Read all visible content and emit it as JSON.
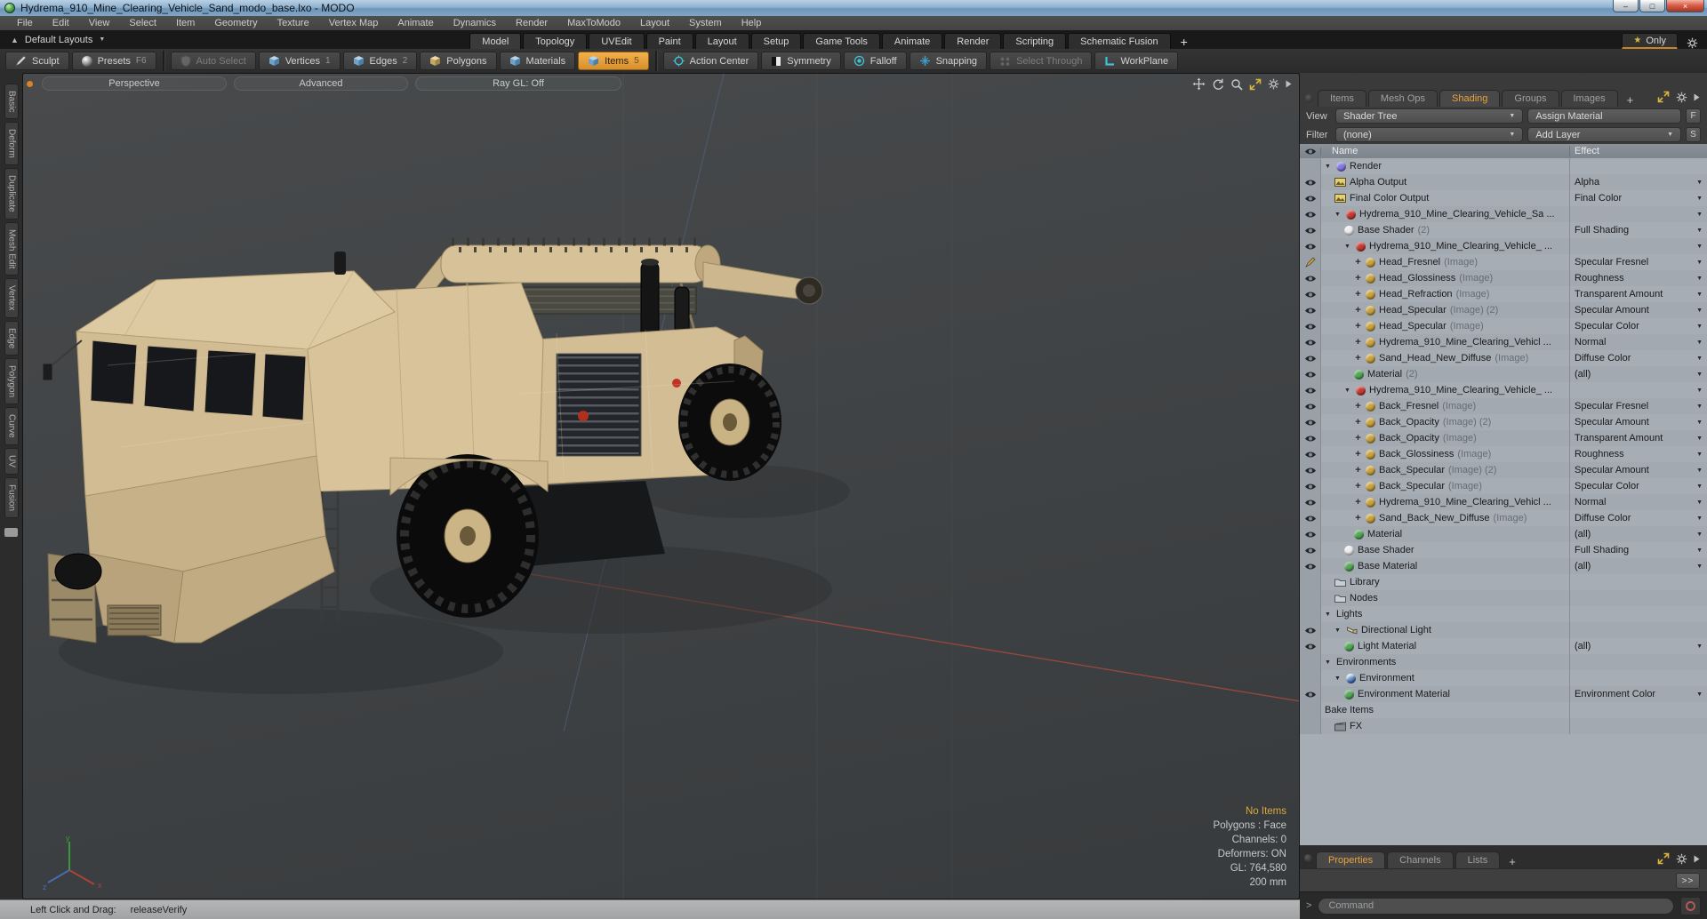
{
  "window": {
    "title": "Hydrema_910_Mine_Clearing_Vehicle_Sand_modo_base.lxo - MODO",
    "controls": {
      "minimize": "–",
      "restore": "□",
      "close": "×"
    }
  },
  "menu": {
    "items": [
      "File",
      "Edit",
      "View",
      "Select",
      "Item",
      "Geometry",
      "Texture",
      "Vertex Map",
      "Animate",
      "Dynamics",
      "Render",
      "MaxToModo",
      "Layout",
      "System",
      "Help"
    ]
  },
  "layout_bar": {
    "layout_switcher": "Default Layouts",
    "tabs": [
      "Model",
      "Topology",
      "UVEdit",
      "Paint",
      "Layout",
      "Setup",
      "Game Tools",
      "Animate",
      "Render",
      "Scripting",
      "Schematic Fusion"
    ],
    "active_tab": "Model",
    "add_tab": "+",
    "only_button": {
      "star": "★",
      "label": "Only"
    }
  },
  "toolbar": {
    "buttons": [
      {
        "label": "Sculpt",
        "icon": "pen"
      },
      {
        "label": "Presets",
        "badge": "F6",
        "icon": "presets-sphere"
      },
      {
        "sep": true
      },
      {
        "label": "Auto Select",
        "icon": "shield",
        "disabled": true
      },
      {
        "label": "Vertices",
        "badge": "1",
        "icon": "cube-blue"
      },
      {
        "label": "Edges",
        "badge": "2",
        "icon": "cube-blue"
      },
      {
        "label": "Polygons",
        "icon": "cube-tan"
      },
      {
        "label": "Materials",
        "icon": "cube-blue"
      },
      {
        "label": "Items",
        "badge": "5",
        "icon": "cube-blue",
        "active": true
      },
      {
        "sep": true
      },
      {
        "label": "Action Center",
        "icon": "action-center"
      },
      {
        "label": "Symmetry",
        "icon": "symmetry"
      },
      {
        "label": "Falloff",
        "icon": "falloff"
      },
      {
        "label": "Snapping",
        "icon": "snapping"
      },
      {
        "label": "Select Through",
        "icon": "select-through",
        "disabled": true
      },
      {
        "label": "WorkPlane",
        "icon": "workplane"
      }
    ]
  },
  "left_tabs": {
    "items": [
      "Basic",
      "Deform",
      "Duplicate",
      "Mesh Edit",
      "Vertex",
      "Edge",
      "Polygon",
      "Curve",
      "UV",
      "Fusion"
    ]
  },
  "viewport": {
    "header_buttons": [
      "Perspective",
      "Advanced",
      "Ray GL: Off"
    ],
    "hud": {
      "highlight": "No Items",
      "lines": [
        "Polygons : Face",
        "Channels: 0",
        "Deformers: ON",
        "GL: 764,580",
        "200 mm"
      ]
    },
    "gizmo_labels": {
      "y": "y",
      "x": "x",
      "z": "z"
    }
  },
  "status_bar": {
    "label": "Left Click and Drag:",
    "value": "releaseVerify"
  },
  "right_panel": {
    "tabs": [
      "Items",
      "Mesh Ops",
      "Shading",
      "Groups",
      "Images"
    ],
    "active_tab": "Shading",
    "add_tab": "+",
    "view_label": "View",
    "view_value": "Shader Tree",
    "assign_material": "Assign Material",
    "f_button": "F",
    "filter_label": "Filter",
    "filter_value": "(none)",
    "add_layer": "Add Layer",
    "s_button": "S",
    "columns": {
      "name": "Name",
      "effect": "Effect"
    },
    "shader_tree": [
      {
        "level": 1,
        "name": "Render",
        "icon": "sphere-render",
        "expanded": true,
        "eye": "",
        "dropdown": false
      },
      {
        "level": 2,
        "name": "Alpha Output",
        "icon": "image-output",
        "effect": "Alpha",
        "eye": "eye",
        "dropdown": true
      },
      {
        "level": 2,
        "name": "Final Color Output",
        "icon": "image-output",
        "effect": "Final Color",
        "eye": "eye",
        "dropdown": true
      },
      {
        "level": 2,
        "name": "Hydrema_910_Mine_Clearing_Vehicle_Sa ...",
        "icon": "sphere-red",
        "expanded": true,
        "eye": "eye",
        "dropdown": true
      },
      {
        "level": 3,
        "name": "Base Shader",
        "dim": "(2)",
        "icon": "sphere-white",
        "effect": "Full Shading",
        "eye": "eye",
        "dropdown": true
      },
      {
        "level": 3,
        "name": "Hydrema_910_Mine_Clearing_Vehicle_ ...",
        "icon": "sphere-red",
        "expanded": true,
        "eye": "eye",
        "dropdown": true
      },
      {
        "level": 4,
        "name": "Head_Fresnel",
        "dim": "(Image)",
        "icon": "sphere-gold",
        "effect": "Specular Fresnel",
        "eye": "brush",
        "plus": true,
        "dropdown": true
      },
      {
        "level": 4,
        "name": "Head_Glossiness",
        "dim": "(Image)",
        "icon": "sphere-gold",
        "effect": "Roughness",
        "eye": "eye",
        "plus": true,
        "dropdown": true
      },
      {
        "level": 4,
        "name": "Head_Refraction",
        "dim": "(Image)",
        "icon": "sphere-gold",
        "effect": "Transparent Amount",
        "eye": "eye",
        "plus": true,
        "dropdown": true
      },
      {
        "level": 4,
        "name": "Head_Specular",
        "dim": "(Image) (2)",
        "icon": "sphere-gold",
        "effect": "Specular Amount",
        "eye": "eye",
        "plus": true,
        "dropdown": true
      },
      {
        "level": 4,
        "name": "Head_Specular",
        "dim": "(Image)",
        "icon": "sphere-gold",
        "effect": "Specular Color",
        "eye": "eye",
        "plus": true,
        "dropdown": true
      },
      {
        "level": 4,
        "name": "Hydrema_910_Mine_Clearing_Vehicl ...",
        "icon": "sphere-gold",
        "effect": "Normal",
        "eye": "eye",
        "plus": true,
        "dropdown": true
      },
      {
        "level": 4,
        "name": "Sand_Head_New_Diffuse",
        "dim": "(Image)",
        "icon": "sphere-gold",
        "effect": "Diffuse Color",
        "eye": "eye",
        "plus": true,
        "dropdown": true
      },
      {
        "level": 4,
        "name": "Material",
        "dim": "(2)",
        "icon": "sphere-green",
        "effect": "(all)",
        "eye": "eye",
        "dropdown": true
      },
      {
        "level": 3,
        "name": "Hydrema_910_Mine_Clearing_Vehicle_ ...",
        "icon": "sphere-red",
        "expanded": true,
        "eye": "eye",
        "dropdown": true
      },
      {
        "level": 4,
        "name": "Back_Fresnel",
        "dim": "(Image)",
        "icon": "sphere-gold",
        "effect": "Specular Fresnel",
        "eye": "eye",
        "plus": true,
        "dropdown": true
      },
      {
        "level": 4,
        "name": "Back_Opacity",
        "dim": "(Image) (2)",
        "icon": "sphere-gold",
        "effect": "Specular Amount",
        "eye": "eye",
        "plus": true,
        "dropdown": true
      },
      {
        "level": 4,
        "name": "Back_Opacity",
        "dim": "(Image)",
        "icon": "sphere-gold",
        "effect": "Transparent Amount",
        "eye": "eye",
        "plus": true,
        "dropdown": true
      },
      {
        "level": 4,
        "name": "Back_Glossiness",
        "dim": "(Image)",
        "icon": "sphere-gold",
        "effect": "Roughness",
        "eye": "eye",
        "plus": true,
        "dropdown": true
      },
      {
        "level": 4,
        "name": "Back_Specular",
        "dim": "(Image) (2)",
        "icon": "sphere-gold",
        "effect": "Specular Amount",
        "eye": "eye",
        "plus": true,
        "dropdown": true
      },
      {
        "level": 4,
        "name": "Back_Specular",
        "dim": "(Image)",
        "icon": "sphere-gold",
        "effect": "Specular Color",
        "eye": "eye",
        "plus": true,
        "dropdown": true
      },
      {
        "level": 4,
        "name": "Hydrema_910_Mine_Clearing_Vehicl ...",
        "icon": "sphere-gold",
        "effect": "Normal",
        "eye": "eye",
        "plus": true,
        "dropdown": true
      },
      {
        "level": 4,
        "name": "Sand_Back_New_Diffuse",
        "dim": "(Image)",
        "icon": "sphere-gold",
        "effect": "Diffuse Color",
        "eye": "eye",
        "plus": true,
        "dropdown": true
      },
      {
        "level": 4,
        "name": "Material",
        "icon": "sphere-green",
        "effect": "(all)",
        "eye": "eye",
        "dropdown": true
      },
      {
        "level": 3,
        "name": "Base Shader",
        "icon": "sphere-white",
        "effect": "Full Shading",
        "eye": "eye",
        "dropdown": true
      },
      {
        "level": 3,
        "name": "Base Material",
        "icon": "sphere-green",
        "effect": "(all)",
        "eye": "eye",
        "dropdown": true
      },
      {
        "level": 2,
        "name": "Library",
        "icon": "folder",
        "eye": "",
        "dropdown": false
      },
      {
        "level": 2,
        "name": "Nodes",
        "icon": "folder",
        "eye": "",
        "dropdown": false
      },
      {
        "level": 1,
        "name": "Lights",
        "expanded": true,
        "eye": "",
        "dropdown": false
      },
      {
        "level": 2,
        "name": "Directional Light",
        "icon": "light",
        "expanded": true,
        "eye": "eye",
        "dropdown": false
      },
      {
        "level": 3,
        "name": "Light Material",
        "icon": "sphere-green",
        "effect": "(all)",
        "eye": "eye",
        "dropdown": true
      },
      {
        "level": 1,
        "name": "Environments",
        "expanded": true,
        "eye": "",
        "dropdown": false
      },
      {
        "level": 2,
        "name": "Environment",
        "icon": "sphere-env",
        "expanded": true,
        "eye": "",
        "dropdown": false
      },
      {
        "level": 3,
        "name": "Environment Material",
        "icon": "sphere-green",
        "effect": "Environment Color",
        "eye": "eye",
        "dropdown": true
      },
      {
        "level": 1,
        "name": "Bake Items",
        "eye": "",
        "dropdown": false
      },
      {
        "level": 2,
        "name": "FX",
        "icon": "clapper",
        "eye": "",
        "dropdown": false
      }
    ],
    "bottom_tabs": [
      "Properties",
      "Channels",
      "Lists"
    ],
    "bottom_active_tab": "Properties",
    "bottom_add_tab": "+",
    "expand_button": ">>",
    "command": {
      "prompt": ">",
      "placeholder": "Command"
    }
  },
  "colors": {
    "accent": "#e8a33d",
    "hud_highlight": "#d8a93f",
    "tree_bg": "#a7adb4",
    "axis_red": "#a84a3e",
    "axis_blue": "#56688e",
    "vehicle_tan": "#d8c49c"
  }
}
